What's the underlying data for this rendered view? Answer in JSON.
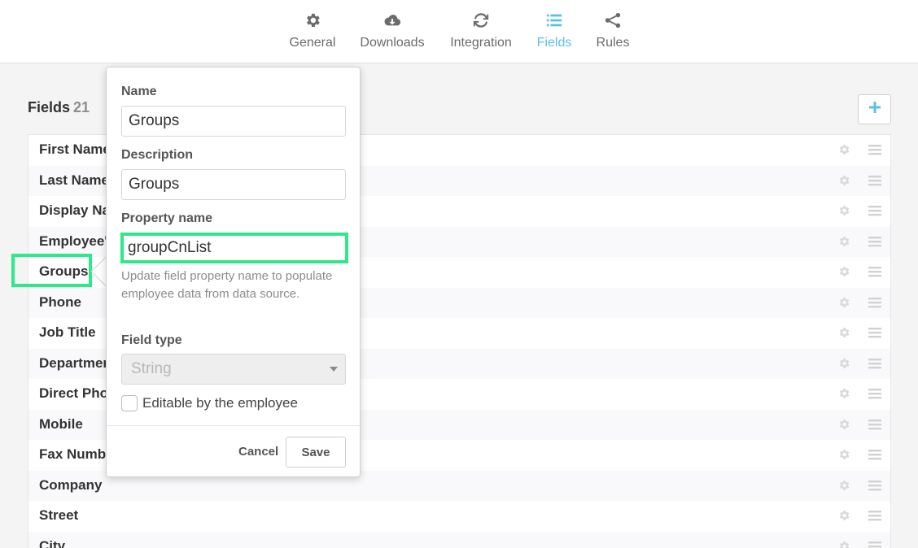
{
  "nav": {
    "items": [
      {
        "label": "General",
        "icon": "gear-icon"
      },
      {
        "label": "Downloads",
        "icon": "cloud-download-icon"
      },
      {
        "label": "Integration",
        "icon": "sync-icon"
      },
      {
        "label": "Fields",
        "icon": "list-icon",
        "active": true
      },
      {
        "label": "Rules",
        "icon": "share-icon"
      }
    ],
    "active_color": "#5bc0e8"
  },
  "fields": {
    "title": "Fields",
    "count": "21",
    "add_label": "+",
    "rows": [
      "First Name",
      "Last Name",
      "Display Name",
      "Employee's",
      "Groups",
      "Phone",
      "Job Title",
      "Department",
      "Direct Phone",
      "Mobile",
      "Fax Number",
      "Company",
      "Street",
      "City"
    ]
  },
  "popover": {
    "name_label": "Name",
    "name_value": "Groups",
    "description_label": "Description",
    "description_value": "Groups",
    "property_label": "Property name",
    "property_value": "groupCnList",
    "help_text": "Update field property name to populate employee data from data source.",
    "field_type_label": "Field type",
    "field_type_value": "String",
    "editable_label": "Editable by the employee",
    "editable_checked": false,
    "cancel_label": "Cancel",
    "save_label": "Save"
  },
  "highlight_color": "#2ee88a"
}
